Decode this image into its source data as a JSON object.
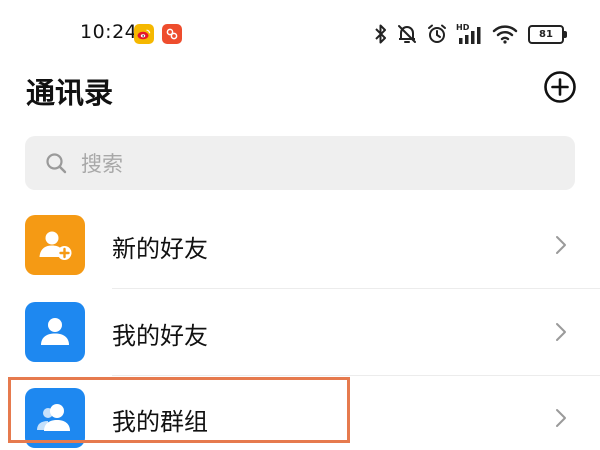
{
  "status_bar": {
    "time": "10:24",
    "battery": "81",
    "hd_label": "HD",
    "icons": [
      "weibo-icon",
      "app-badge-icon",
      "bluetooth-icon",
      "mute-bell-icon",
      "alarm-icon",
      "signal-icon",
      "wifi-icon",
      "battery-icon"
    ]
  },
  "header": {
    "title": "通讯录",
    "add_icon": "plus-circle-icon"
  },
  "search": {
    "placeholder": "搜索",
    "icon": "search-icon"
  },
  "contacts_menu": {
    "items": [
      {
        "label": "新的好友",
        "icon": "add-friend-icon",
        "color": "#f59a14"
      },
      {
        "label": "我的好友",
        "icon": "person-icon",
        "color": "#1e88f0"
      },
      {
        "label": "我的群组",
        "icon": "group-icon",
        "color": "#1e88f0"
      }
    ]
  },
  "colors": {
    "accent_orange": "#f59a14",
    "accent_blue": "#1e88f0",
    "highlight": "#e67a4e"
  }
}
